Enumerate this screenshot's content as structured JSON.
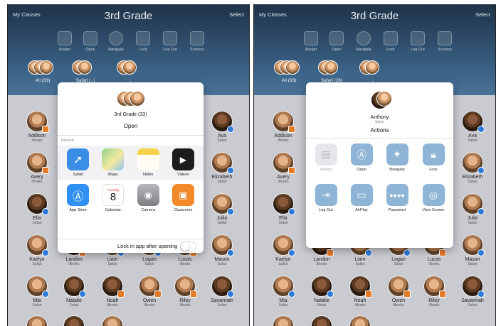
{
  "left": {
    "header": {
      "my_classes": "My Classes",
      "title": "3rd Grade",
      "select": "Select"
    },
    "toolbar": [
      {
        "label": "Assign",
        "icon": "assign-icon"
      },
      {
        "label": "Open",
        "icon": "app-store-icon"
      },
      {
        "label": "Navigate",
        "icon": "compass-icon"
      },
      {
        "label": "Lock",
        "icon": "lock-icon"
      },
      {
        "label": "Log Out",
        "icon": "logout-icon"
      },
      {
        "label": "Screens",
        "icon": "screens-icon"
      }
    ],
    "groups": [
      {
        "label": "All (33)"
      },
      {
        "label": "Safari (..)"
      },
      {
        "label": ".."
      }
    ],
    "students": [
      {
        "name": "Addison",
        "app": "iBooks"
      },
      {
        "name": "Ava",
        "app": "Safari"
      },
      {
        "name": "Avery",
        "app": "iBooks"
      },
      {
        "name": "Elizabeth",
        "app": "Safari"
      },
      {
        "name": "Ella",
        "app": "Safari"
      },
      {
        "name": "Julia",
        "app": "Safari"
      },
      {
        "name": "Kaelyn",
        "app": "Safari"
      },
      {
        "name": "Landon",
        "app": "iBooks"
      },
      {
        "name": "Liam",
        "app": "Safari"
      },
      {
        "name": "Logan",
        "app": "Safari"
      },
      {
        "name": "Lucas",
        "app": "iBooks"
      },
      {
        "name": "Mason",
        "app": "Safari"
      },
      {
        "name": "Mia",
        "app": "Safari"
      },
      {
        "name": "Natalie",
        "app": "Safari"
      },
      {
        "name": "Noah",
        "app": "iBooks"
      },
      {
        "name": "Owen",
        "app": "iBooks"
      },
      {
        "name": "Riley",
        "app": "iBooks"
      },
      {
        "name": "Savannah",
        "app": "Safari"
      }
    ],
    "popover": {
      "group_title": "3rd Grade (33)",
      "heading": "Open",
      "recent_label": "Recent",
      "apps_row1": [
        {
          "label": "Safari",
          "icon": "safari-icon",
          "color": "#3a8ee6"
        },
        {
          "label": "Maps",
          "icon": "maps-icon",
          "color": "#6cc07a"
        },
        {
          "label": "Notes",
          "icon": "notes-icon",
          "color": "#f6d24a"
        },
        {
          "label": "Videos",
          "icon": "videos-icon",
          "color": "#1c1c1e"
        }
      ],
      "apps_row2": [
        {
          "label": "App Store",
          "icon": "app-store-icon",
          "color": "#2f8ff2"
        },
        {
          "label": "Calendar",
          "icon": "calendar-icon",
          "color": "#ffffff",
          "day_name": "Tuesday",
          "day": "8"
        },
        {
          "label": "Camera",
          "icon": "camera-icon",
          "color": "#8e8e93"
        },
        {
          "label": "Classroom",
          "icon": "classroom-icon",
          "color": "#f28a2a"
        }
      ],
      "lock_label": "Lock in app after opening"
    }
  },
  "right": {
    "header": {
      "my_classes": "My Classes",
      "title": "3rd Grade",
      "select": "Select"
    },
    "toolbar": [
      {
        "label": "Assign",
        "icon": "assign-icon"
      },
      {
        "label": "Open",
        "icon": "app-store-icon"
      },
      {
        "label": "Navigate",
        "icon": "compass-icon"
      },
      {
        "label": "Lock",
        "icon": "lock-icon"
      },
      {
        "label": "Log Out",
        "icon": "logout-icon"
      },
      {
        "label": "Screens",
        "icon": "screens-icon"
      }
    ],
    "groups": [
      {
        "label": "All (33)"
      },
      {
        "label": "Safari (26)"
      },
      {
        "label": ".."
      }
    ],
    "students": [
      {
        "name": "Addison",
        "app": "iBooks"
      },
      {
        "name": "Ava",
        "app": "Safari"
      },
      {
        "name": "Avery",
        "app": "iBooks"
      },
      {
        "name": "Elizabeth",
        "app": "Safari"
      },
      {
        "name": "Ella",
        "app": "Safari"
      },
      {
        "name": "Julia",
        "app": "Safari"
      },
      {
        "name": "Kaelyn",
        "app": "Safari"
      },
      {
        "name": "Landon",
        "app": "iBooks"
      },
      {
        "name": "Liam",
        "app": "Safari"
      },
      {
        "name": "Logan",
        "app": "Safari"
      },
      {
        "name": "Lucas",
        "app": "iBooks"
      },
      {
        "name": "Mason",
        "app": "Safari"
      },
      {
        "name": "Mia",
        "app": "Safari"
      },
      {
        "name": "Natalie",
        "app": "Safari"
      },
      {
        "name": "Noah",
        "app": "iBooks"
      },
      {
        "name": "Owen",
        "app": "iBooks"
      },
      {
        "name": "Riley",
        "app": "iBooks"
      },
      {
        "name": "Savannah",
        "app": "Safari"
      }
    ],
    "popover": {
      "student_name": "Anthony",
      "student_app": "Safari",
      "heading": "Actions",
      "actions": [
        {
          "label": "Assign",
          "icon": "assign-icon",
          "enabled": false
        },
        {
          "label": "Open",
          "icon": "app-store-icon",
          "enabled": true
        },
        {
          "label": "Navigate",
          "icon": "compass-icon",
          "enabled": true
        },
        {
          "label": "Lock",
          "icon": "lock-icon",
          "enabled": true
        },
        {
          "label": "Log Out",
          "icon": "logout-icon",
          "enabled": true
        },
        {
          "label": "AirPlay",
          "icon": "airplay-icon",
          "enabled": true
        },
        {
          "label": "Password",
          "icon": "password-icon",
          "enabled": true
        },
        {
          "label": "View Screen",
          "icon": "view-screen-icon",
          "enabled": true
        }
      ]
    }
  },
  "colors": {
    "header_top": "#1e3348",
    "header_bottom": "#4a7297",
    "action_tile": "#8fb5d6",
    "app_badge": "#2d7ad9",
    "ibooks_badge": "#e57a27"
  }
}
